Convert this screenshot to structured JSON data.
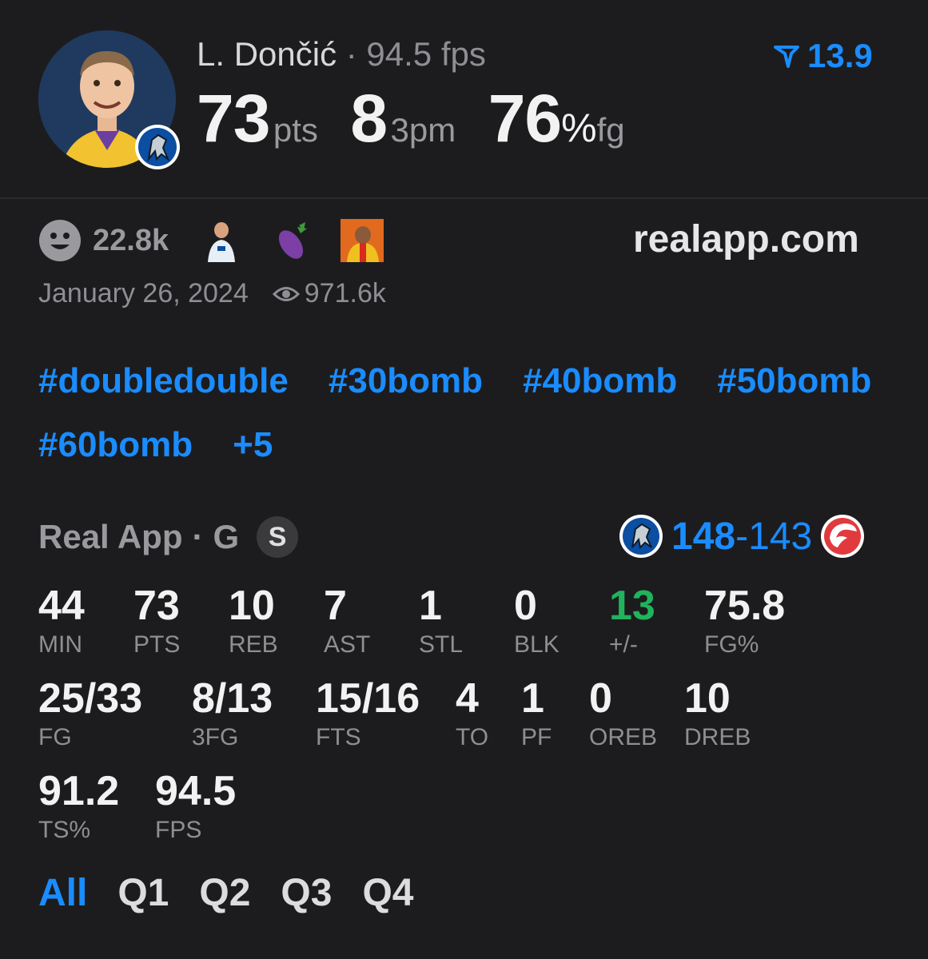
{
  "player": {
    "name": "L. Dončić",
    "fps_text": "94.5 fps",
    "headline": [
      {
        "value": "73",
        "unit": "pts"
      },
      {
        "value": "8",
        "unit": "3pm"
      },
      {
        "value": "76",
        "unit": "fg",
        "pct": "%"
      }
    ]
  },
  "fscore": {
    "value": "13.9"
  },
  "reactions": {
    "count": "22.8k",
    "emojis": [
      "player-reaction-icon",
      "eggplant-icon",
      "hotline-meme-icon"
    ]
  },
  "site": "realapp.com",
  "post": {
    "date": "January 26, 2024",
    "views": "971.6k"
  },
  "tags": [
    "#doubledouble",
    "#30bomb",
    "#40bomb",
    "#50bomb",
    "#60bomb",
    "+5"
  ],
  "game": {
    "source": "Real App",
    "position": "G",
    "badge": "S",
    "home_score": "148",
    "separator": "-",
    "away_score": "143"
  },
  "stats_rows": [
    [
      {
        "value": "44",
        "label": "MIN"
      },
      {
        "value": "73",
        "label": "PTS"
      },
      {
        "value": "10",
        "label": "REB"
      },
      {
        "value": "7",
        "label": "AST"
      },
      {
        "value": "1",
        "label": "STL"
      },
      {
        "value": "0",
        "label": "BLK"
      },
      {
        "value": "13",
        "label": "+/-"
      },
      {
        "value": "75.8",
        "label": "FG%"
      }
    ],
    [
      {
        "value": "25/33",
        "label": "FG"
      },
      {
        "value": "8/13",
        "label": "3FG"
      },
      {
        "value": "15/16",
        "label": "FTS"
      },
      {
        "value": "4",
        "label": "TO"
      },
      {
        "value": "1",
        "label": "PF"
      },
      {
        "value": "0",
        "label": "OREB"
      },
      {
        "value": "10",
        "label": "DREB"
      }
    ],
    [
      {
        "value": "91.2",
        "label": "TS%"
      },
      {
        "value": "94.5",
        "label": "FPS"
      }
    ]
  ],
  "tabs": [
    "All",
    "Q1",
    "Q2",
    "Q3",
    "Q4"
  ],
  "colors": {
    "accent": "#1a8cff",
    "positive": "#21b35c",
    "background": "#1c1c1e"
  }
}
